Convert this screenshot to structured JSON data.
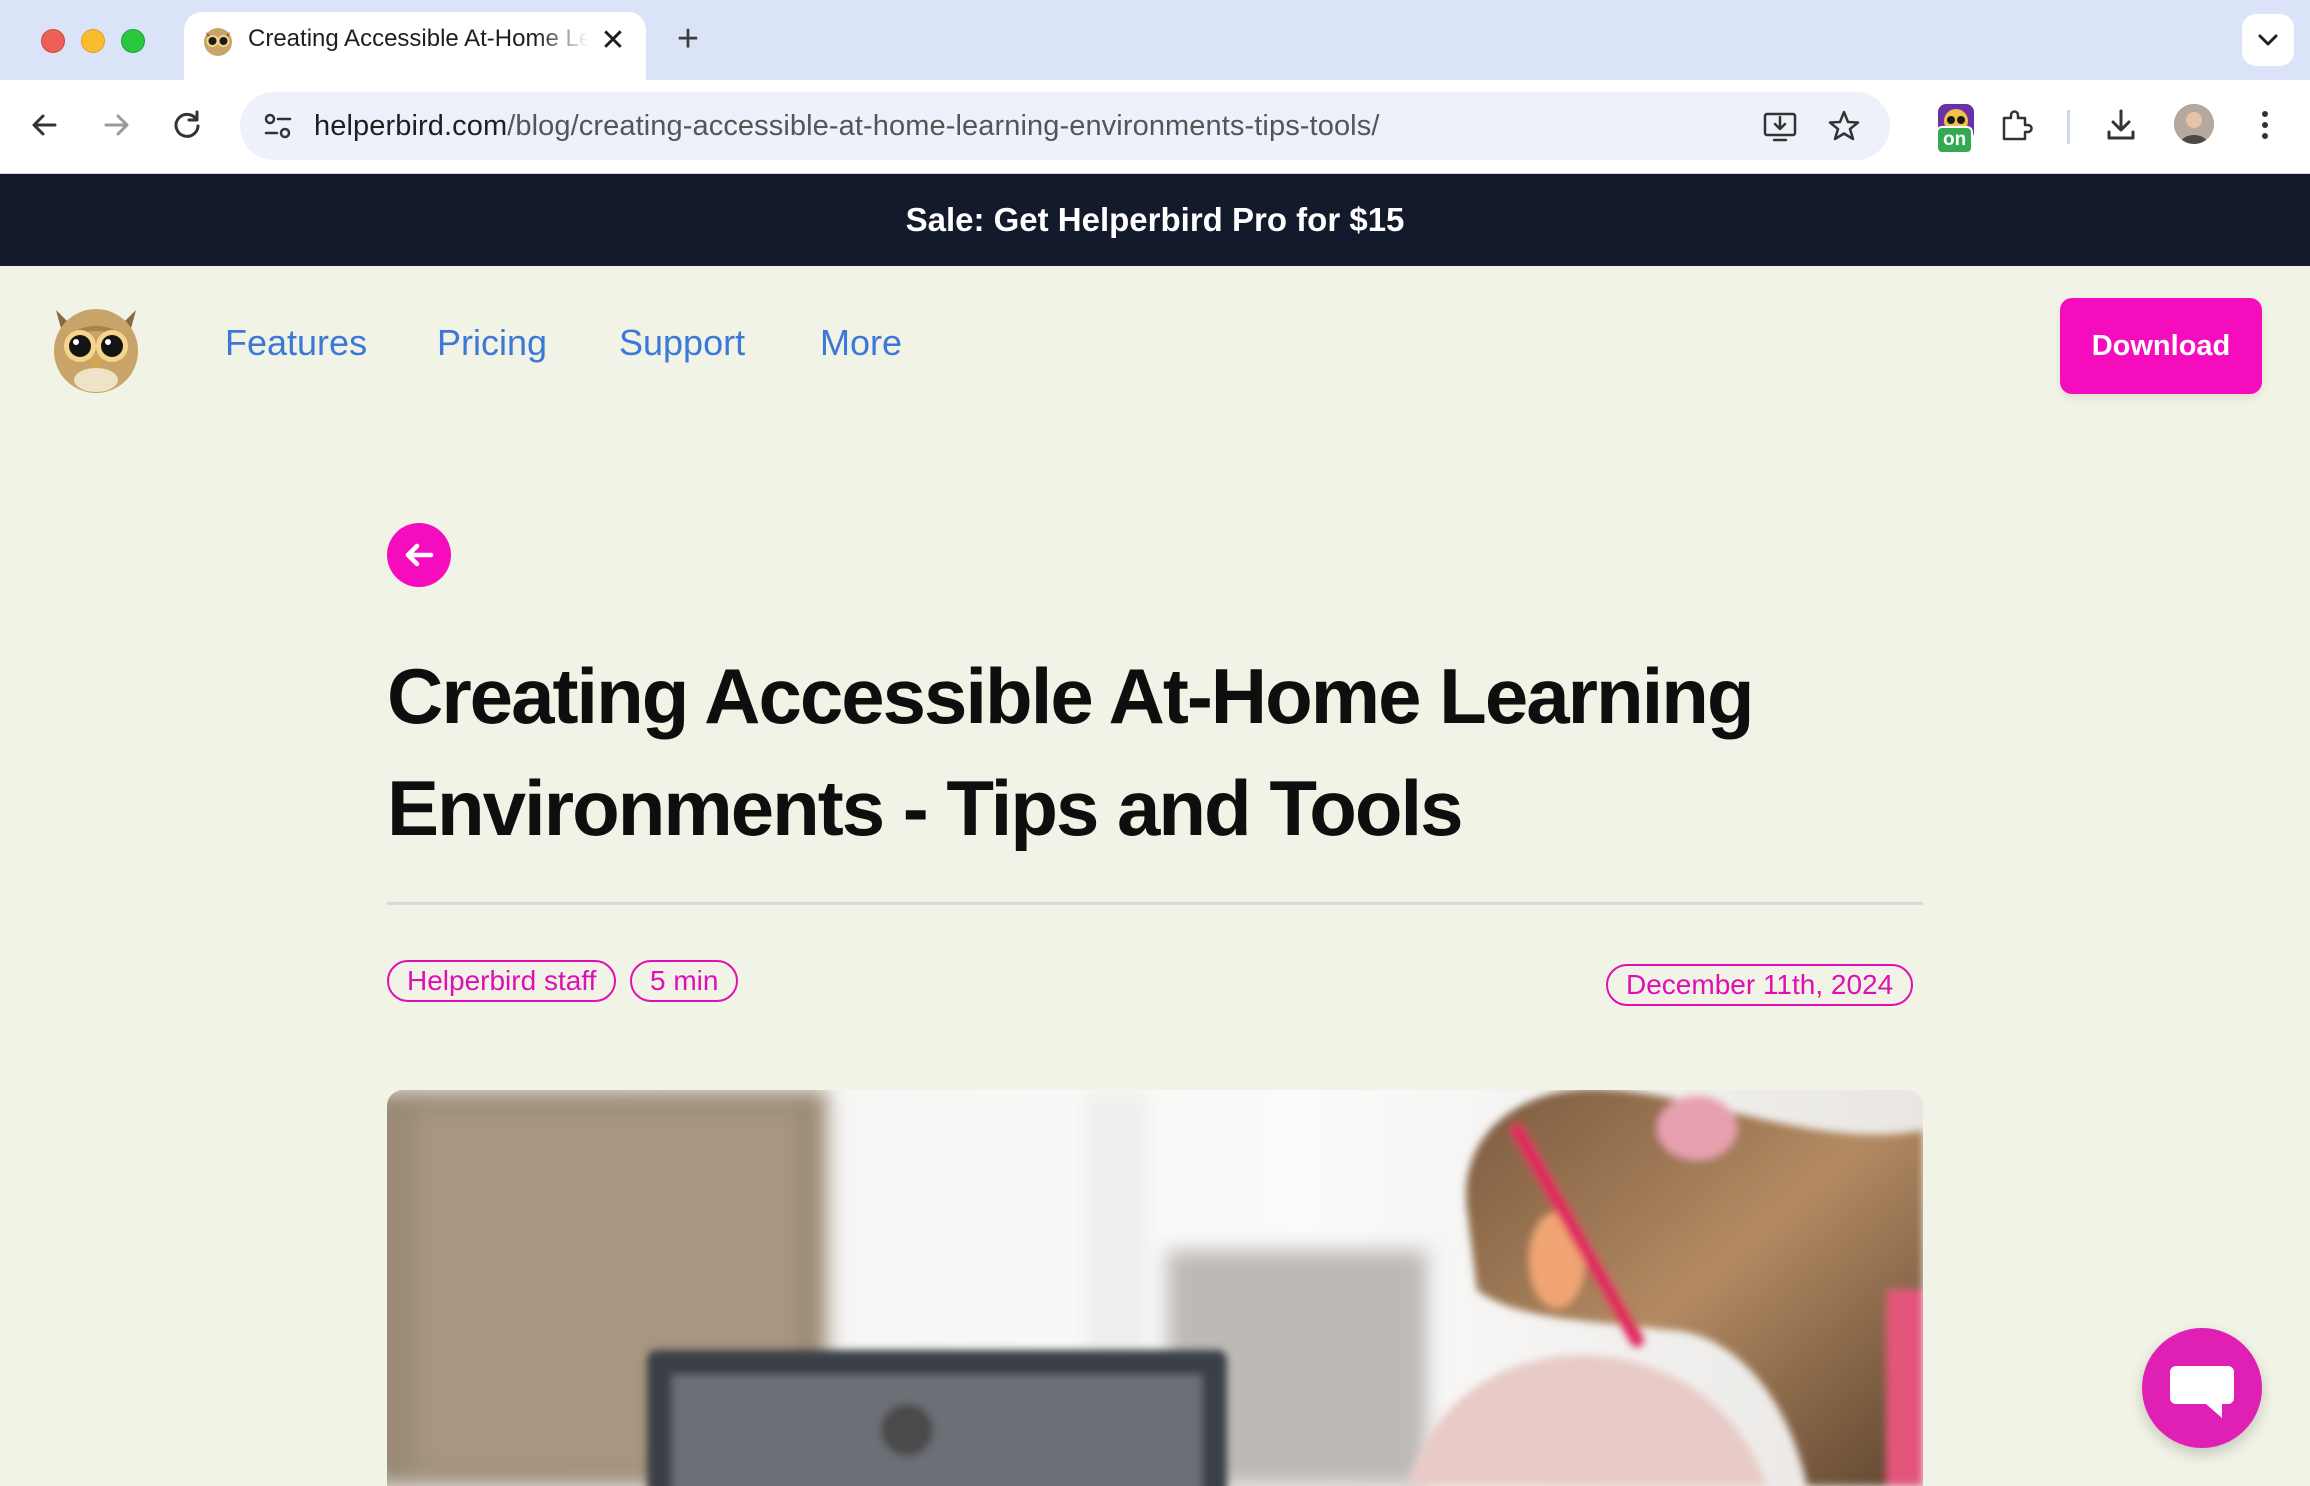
{
  "browser": {
    "tab_title": "Creating Accessible At-Home Learning Environments - Tips and Tools",
    "url_host": "helperbird.com",
    "url_path": "/blog/creating-accessible-at-home-learning-environments-tips-tools/",
    "extension_badge": "on",
    "icons": [
      "back-arrow-icon",
      "forward-arrow-icon",
      "reload-icon",
      "site-settings-icon",
      "install-app-icon",
      "star-icon",
      "extensions-puzzle-icon",
      "download-icon",
      "kebab-menu-icon",
      "chevron-down-icon",
      "close-icon",
      "plus-icon"
    ]
  },
  "banner": {
    "text": "Sale: Get Helperbird Pro for $15"
  },
  "nav": {
    "items": [
      {
        "label": "Features"
      },
      {
        "label": "Pricing"
      },
      {
        "label": "Support"
      },
      {
        "label": "More"
      }
    ],
    "download_label": "Download"
  },
  "article": {
    "title": "Creating Accessible At-Home Learning Environments - Tips and Tools",
    "author": "Helperbird staff",
    "read_time": "5 min",
    "date": "December 11th, 2024"
  },
  "colors": {
    "accent": "#f50dbd",
    "banner_bg": "#121a2b",
    "page_bg": "#f1f3e6",
    "nav_link": "#3c78d8"
  }
}
